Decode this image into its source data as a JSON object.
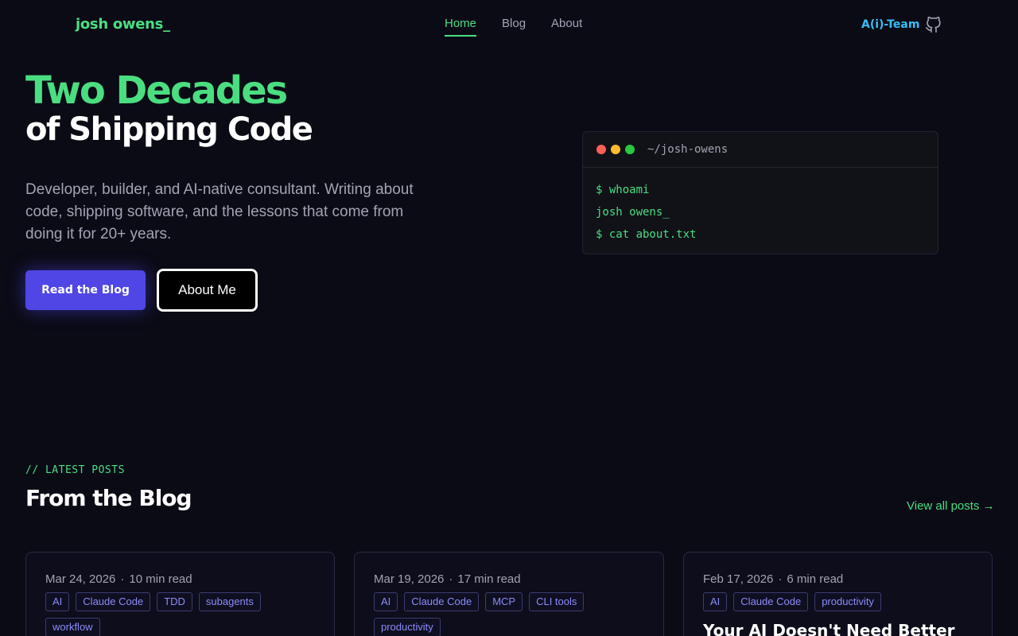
{
  "header": {
    "logo": "josh owens_",
    "nav": [
      {
        "label": "Home",
        "active": true
      },
      {
        "label": "Blog",
        "active": false
      },
      {
        "label": "About",
        "active": false
      }
    ],
    "team_link": "A(i)-Team",
    "github_icon": "github-icon"
  },
  "hero": {
    "title_line1": "Two Decades",
    "title_line2": "of Shipping Code",
    "description": "Developer, builder, and AI-native consultant. Writing about code, shipping software, and the lessons that come from doing it for 20+ years.",
    "primary_button": "Read the Blog",
    "secondary_button": "About Me"
  },
  "terminal": {
    "path": "~/josh-owens",
    "lines": [
      "$ whoami",
      "josh owens_",
      "$ cat about.txt"
    ]
  },
  "blog": {
    "tag": "// LATEST POSTS",
    "title": "From the Blog",
    "view_all": "View all posts →",
    "separator": "·",
    "posts": [
      {
        "date": "Mar 24, 2026",
        "read_time": "10 min read",
        "tags": [
          "AI",
          "Claude Code",
          "TDD",
          "subagents",
          "workflow"
        ],
        "title": ""
      },
      {
        "date": "Mar 19, 2026",
        "read_time": "17 min read",
        "tags": [
          "AI",
          "Claude Code",
          "MCP",
          "CLI tools",
          "productivity"
        ],
        "title": ""
      },
      {
        "date": "Feb 17, 2026",
        "read_time": "6 min read",
        "tags": [
          "AI",
          "Claude Code",
          "productivity"
        ],
        "title": "Your AI Doesn't Need Better"
      }
    ]
  },
  "colors": {
    "background": "#0b0b16",
    "accent_green": "#4ade80",
    "primary_button": "#4f46e5",
    "team_link": "#38bdf8",
    "tag_text": "#8b8cf7"
  }
}
